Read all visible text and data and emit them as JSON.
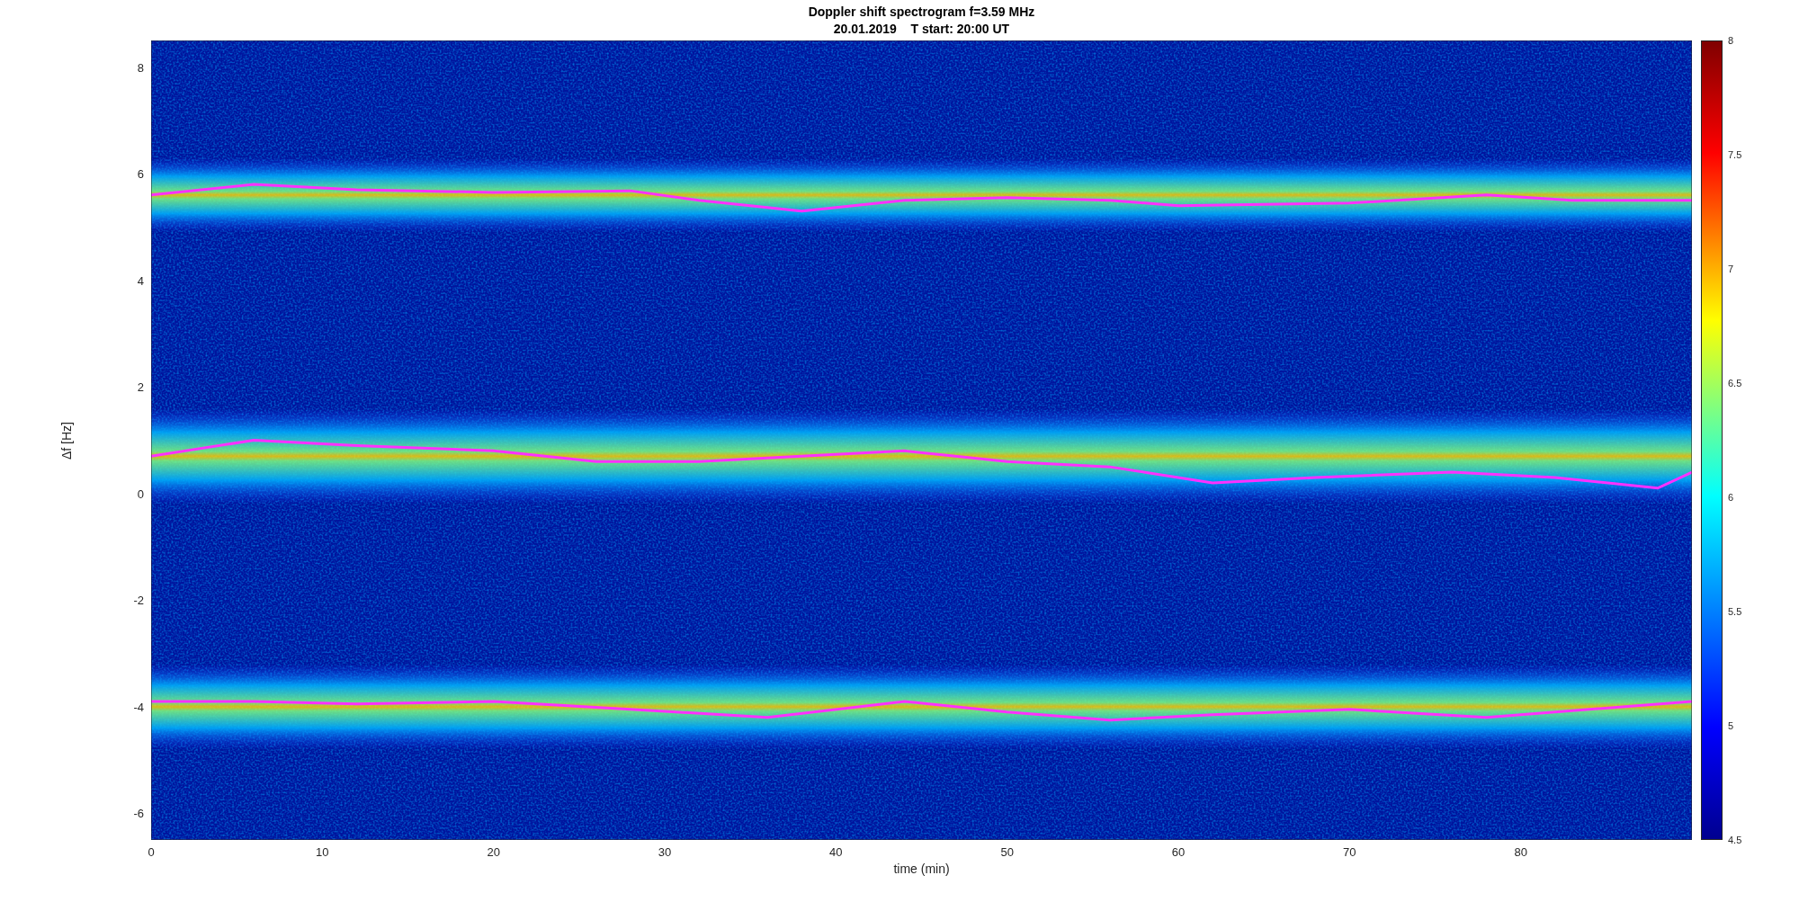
{
  "title": [
    "Doppler shift spectrogram f=3.59 MHz",
    "20.01.2019    T start: 20:00 UT"
  ],
  "axes": {
    "ylabel": "Δf [Hz]",
    "xlabel": "time (min)",
    "yticks": [
      "8",
      "6",
      "4",
      "2",
      "0",
      "-2",
      "-4",
      "-6"
    ],
    "xticks": [
      "0",
      "10",
      "20",
      "30",
      "40",
      "50",
      "60",
      "70",
      "80"
    ]
  },
  "colorbar": {
    "ticks": [
      "8",
      "7.5",
      "7",
      "6.5",
      "6",
      "5.5",
      "5",
      "4.5"
    ]
  }
}
